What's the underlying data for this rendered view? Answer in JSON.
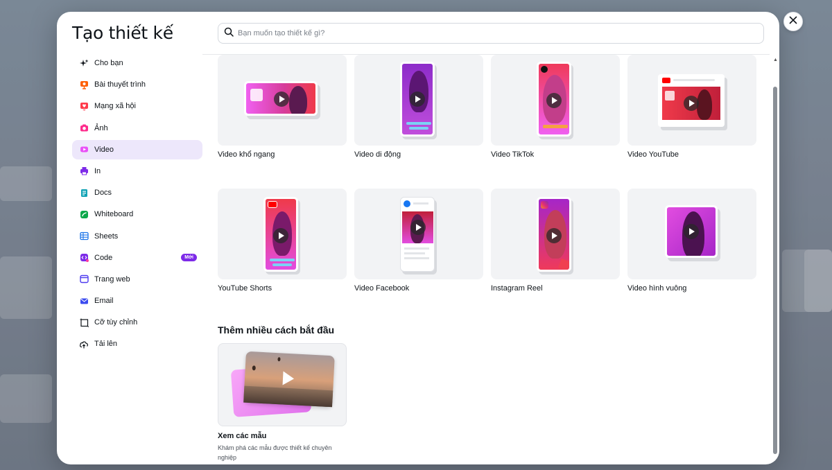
{
  "modal": {
    "title": "Tạo thiết kế",
    "search_placeholder": "Bạn muốn tạo thiết kế gì?"
  },
  "sidebar": {
    "items": [
      {
        "label": "Cho bạn",
        "icon": "sparkle-icon",
        "color": "#0e1318"
      },
      {
        "label": "Bài thuyết trình",
        "icon": "presentation-icon",
        "color": "#ff6105"
      },
      {
        "label": "Mạng xã hội",
        "icon": "heart-icon",
        "color": "#ff3b4b"
      },
      {
        "label": "Ảnh",
        "icon": "camera-icon",
        "color": "#fe2c8c"
      },
      {
        "label": "Video",
        "icon": "video-icon",
        "color": "#e950f7",
        "active": true
      },
      {
        "label": "In",
        "icon": "printer-icon",
        "color": "#7d2ae8"
      },
      {
        "label": "Docs",
        "icon": "docs-icon",
        "color": "#13a3b5"
      },
      {
        "label": "Whiteboard",
        "icon": "whiteboard-icon",
        "color": "#0ba84a"
      },
      {
        "label": "Sheets",
        "icon": "sheets-icon",
        "color": "#1a73e8"
      },
      {
        "label": "Code",
        "icon": "code-icon",
        "color": "#7d2ae8",
        "badge": "Mới"
      },
      {
        "label": "Trang web",
        "icon": "website-icon",
        "color": "#4b39ef"
      },
      {
        "label": "Email",
        "icon": "email-icon",
        "color": "#3b4bef"
      },
      {
        "label": "Cỡ tùy chỉnh",
        "icon": "custom-size-icon",
        "color": "#0e1318"
      },
      {
        "label": "Tải lên",
        "icon": "upload-cloud-icon",
        "color": "#0e1318"
      }
    ]
  },
  "video_types": [
    {
      "label": "Video khổ ngang"
    },
    {
      "label": "Video di động"
    },
    {
      "label": "Video TikTok"
    },
    {
      "label": "Video YouTube"
    },
    {
      "label": "YouTube Shorts"
    },
    {
      "label": "Video Facebook"
    },
    {
      "label": "Instagram Reel"
    },
    {
      "label": "Video hình vuông"
    }
  ],
  "more": {
    "section_title": "Thêm nhiều cách bắt đầu",
    "template_title": "Xem các mẫu",
    "template_desc": "Khám phá các mẫu được thiết kế chuyên nghiệp"
  },
  "colors": {
    "accent": "#7d2ae8",
    "active_bg": "#ede7fb",
    "magenta": "#e24de0",
    "red": "#ef3a4a"
  }
}
